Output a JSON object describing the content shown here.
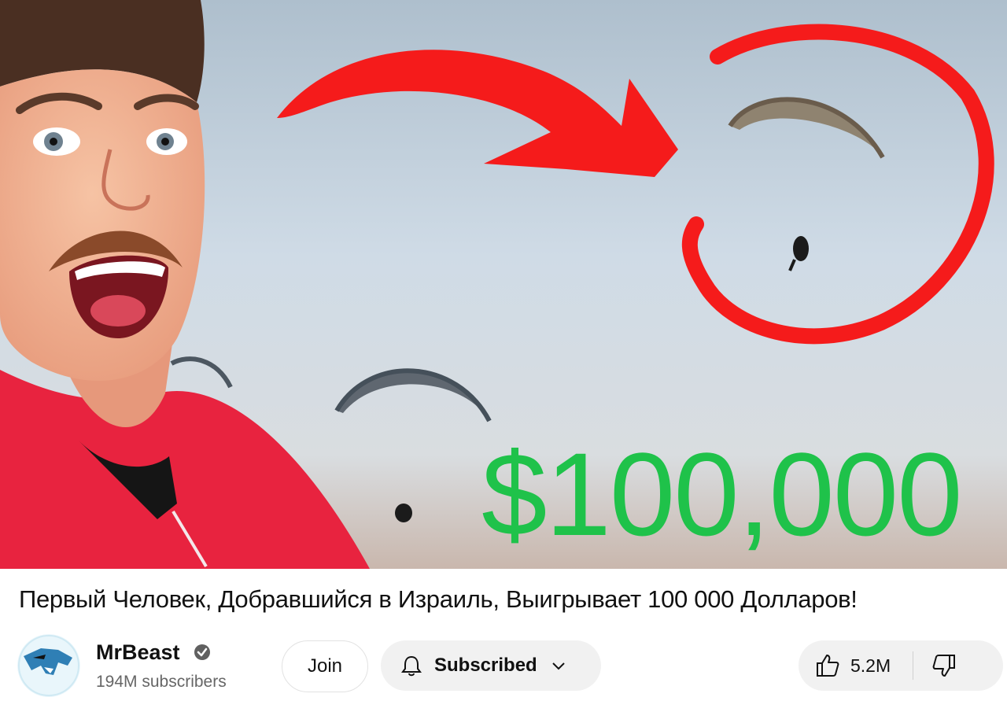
{
  "thumbnail": {
    "price_text": "$100,000",
    "colors": {
      "sky": "#c9d6e2",
      "arrow": "#f51b1b",
      "price": "#1fc24a",
      "hoodie": "#e8233f"
    }
  },
  "video": {
    "title": "Первый Человек, Добравшийся в Израиль, Выигрывает 100 000 Долларов!"
  },
  "channel": {
    "name": "MrBeast",
    "subscribers": "194M subscribers",
    "avatar_icon": "mrbeast-panther-logo",
    "verified_icon": "verified-check-icon"
  },
  "actions": {
    "join_label": "Join",
    "subscribe_label": "Subscribed",
    "like_count": "5.2M"
  }
}
